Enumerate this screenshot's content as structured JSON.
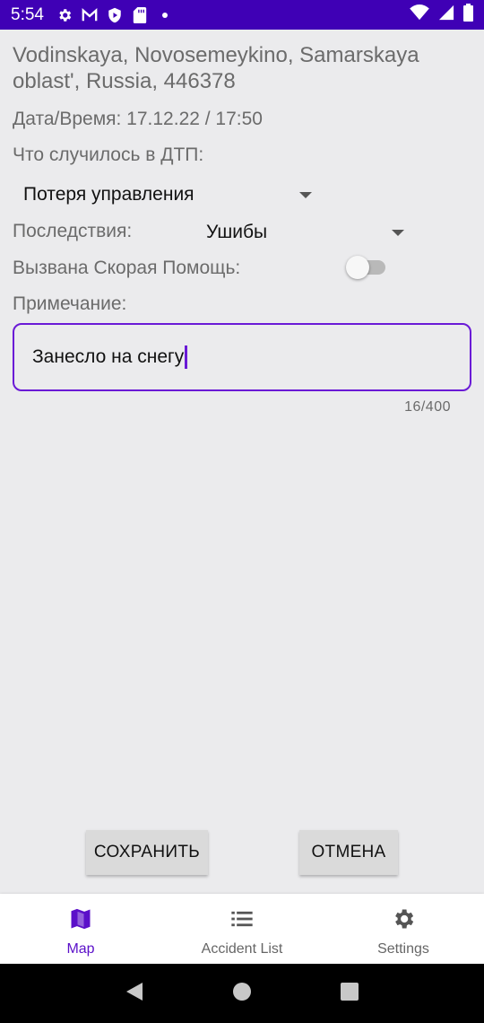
{
  "status_bar": {
    "time": "5:54",
    "left_icons": [
      "settings-icon",
      "gmail-icon",
      "play-protect-icon",
      "sd-card-icon",
      "dot-icon"
    ],
    "right_icons": [
      "wifi-icon",
      "signal-icon",
      "battery-icon"
    ]
  },
  "form": {
    "address": "Vodinskaya, Novosemeykino, Samarskaya oblast', Russia, 446378",
    "datetime": "Дата/Время: 17.12.22 / 17:50",
    "what_happened_label": "Что случилось в ДТП:",
    "what_happened_value": "Потеря управления",
    "consequences_label": "Последствия:",
    "consequences_value": "Ушибы",
    "ambulance_label": "Вызвана Скорая Помощь:",
    "ambulance_on": false,
    "note_label": "Примечание:",
    "note_value": "Занесло на снегу",
    "note_counter": "16/400"
  },
  "buttons": {
    "save": "СОХРАНИТЬ",
    "cancel": "ОТМЕНА"
  },
  "bottom_nav": {
    "items": [
      {
        "label": "Map",
        "icon": "map-icon",
        "active": true
      },
      {
        "label": "Accident List",
        "icon": "list-icon",
        "active": false
      },
      {
        "label": "Settings",
        "icon": "gear-icon",
        "active": false
      }
    ]
  },
  "colors": {
    "status_bar": "#3f00b5",
    "accent": "#6a1ad6",
    "background": "#ebebed"
  }
}
